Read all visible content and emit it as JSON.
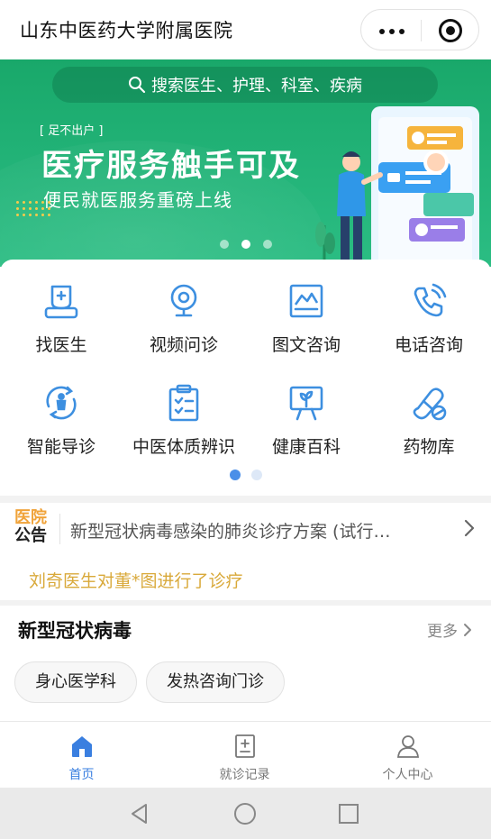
{
  "header": {
    "title": "山东中医药大学附属医院"
  },
  "banner": {
    "search_placeholder": "搜索医生、护理、科室、疾病",
    "tag": "[ 足不出户 ]",
    "headline": "医疗服务触手可及",
    "subline": "便民就医服务重磅上线",
    "slide_count": 3,
    "active_slide": 2
  },
  "services": {
    "items": [
      {
        "label": "找医生",
        "icon": "doctor-icon"
      },
      {
        "label": "视频问诊",
        "icon": "video-camera-icon"
      },
      {
        "label": "图文咨询",
        "icon": "image-chat-icon"
      },
      {
        "label": "电话咨询",
        "icon": "phone-icon"
      },
      {
        "label": "智能导诊",
        "icon": "smart-guide-icon"
      },
      {
        "label": "中医体质辨识",
        "icon": "clipboard-icon"
      },
      {
        "label": "健康百科",
        "icon": "health-board-icon"
      },
      {
        "label": "药物库",
        "icon": "pill-icon"
      }
    ],
    "page_count": 2,
    "active_page": 1
  },
  "notice": {
    "badge_top": "医院",
    "badge_bottom": "公告",
    "text": "新型冠状病毒感染的肺炎诊疗方案 (试行…"
  },
  "ticker": {
    "text": "刘奇医生对董*图进行了诊疗"
  },
  "covid": {
    "title": "新型冠状病毒",
    "more_label": "更多",
    "chips": [
      "身心医学科",
      "发热咨询门诊"
    ]
  },
  "tabbar": {
    "tabs": [
      {
        "label": "首页",
        "icon": "home-icon",
        "active": true
      },
      {
        "label": "就诊记录",
        "icon": "record-icon",
        "active": false
      },
      {
        "label": "个人中心",
        "icon": "user-icon",
        "active": false
      }
    ]
  },
  "colors": {
    "banner_green": "#23b479",
    "accent_blue": "#3a7fe0",
    "icon_blue": "#3d8fe0",
    "notice_orange": "#f0a33a",
    "ticker_gold": "#d9a93a"
  }
}
